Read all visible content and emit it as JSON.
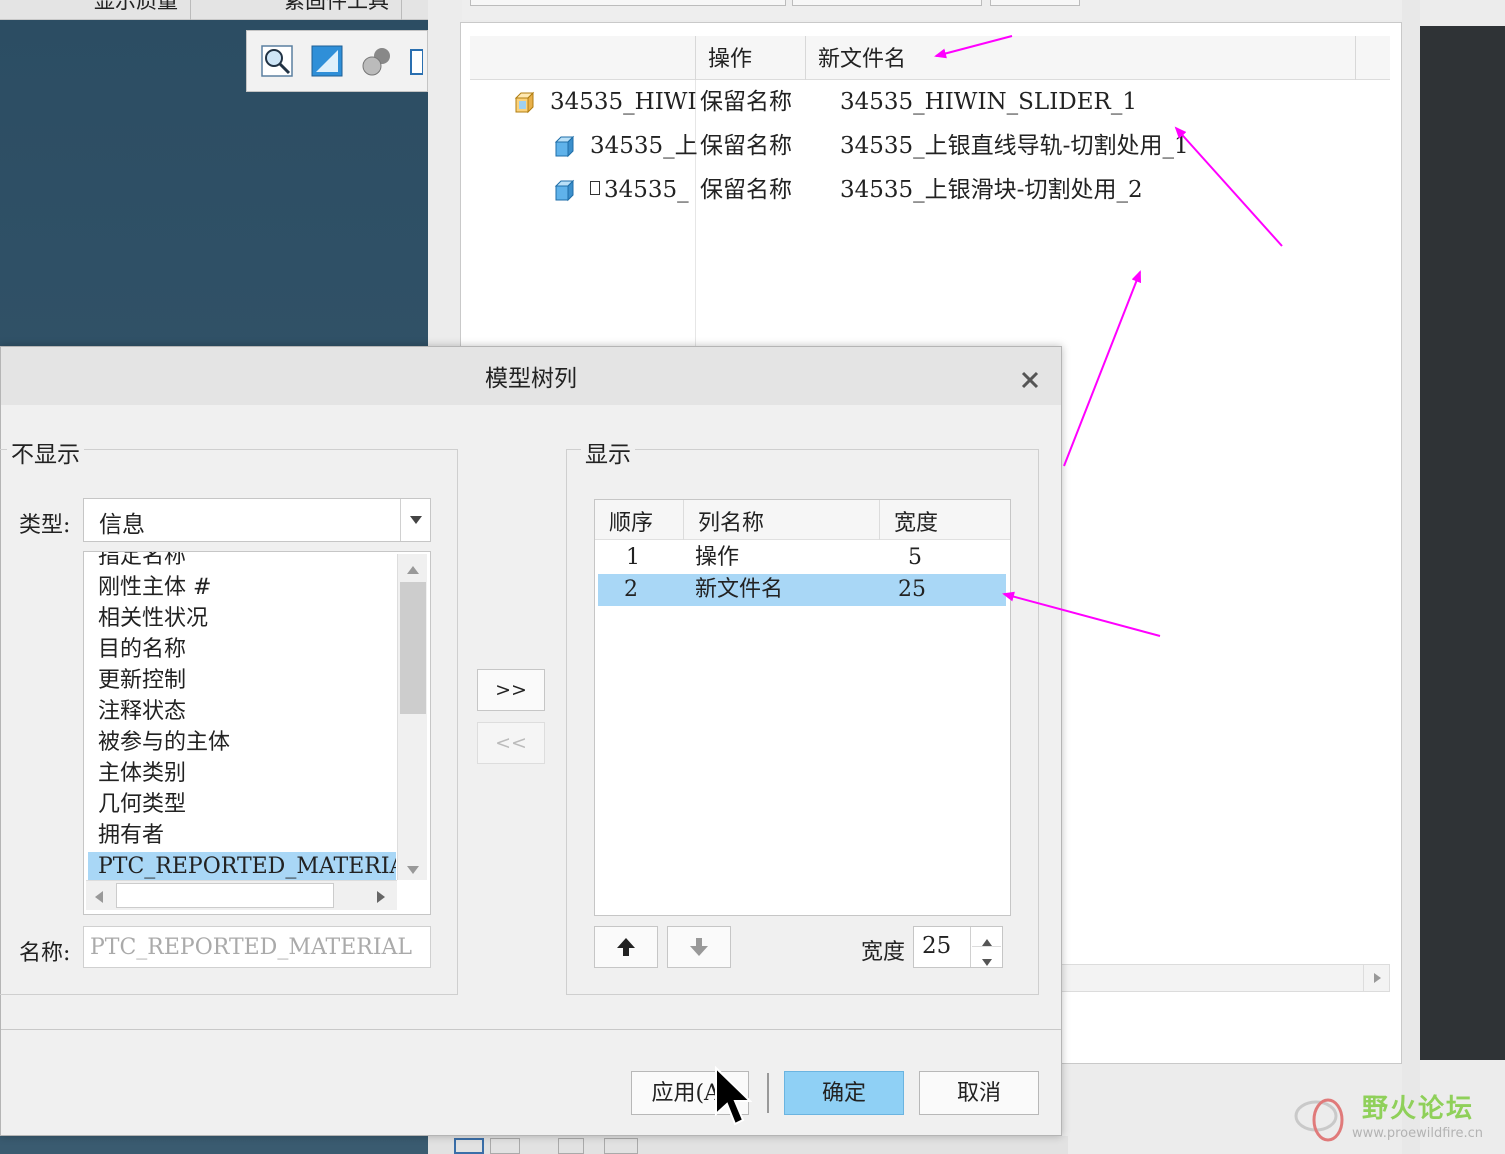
{
  "top_tabs": [
    "显示质量",
    "紧固件工具"
  ],
  "model_tree": {
    "columns": [
      "操作",
      "新文件名"
    ],
    "rows": [
      {
        "name": "34535_HIWI",
        "op": "保留名称",
        "newname": "34535_HIWIN_SLIDER_1"
      },
      {
        "name": "34535_上",
        "op": "保留名称",
        "newname": "34535_上银直线导轨-切割处用_1"
      },
      {
        "name": "34535_",
        "op": "保留名称",
        "newname": "34535_上银滑块-切割处用_2"
      }
    ]
  },
  "dialog": {
    "title": "模型树列",
    "left_group": "不显示",
    "type_label": "类型:",
    "type_value": "信息",
    "available_items": [
      "指定名称",
      "刚性主体 #",
      "相关性状况",
      "目的名称",
      "更新控制",
      "注释状态",
      "被参与的主体",
      "主体类别",
      "几何类型",
      "拥有者",
      "PTC_REPORTED_MATERIAL"
    ],
    "selected_available": "PTC_REPORTED_MATERIAL",
    "name_label": "名称:",
    "name_value": "PTC_REPORTED_MATERIAL",
    "add_button": ">>",
    "remove_button": "<<",
    "right_group": "显示",
    "shown_columns": [
      "顺序",
      "列名称",
      "宽度"
    ],
    "shown_rows": [
      {
        "order": "1",
        "name": "操作",
        "width": "5"
      },
      {
        "order": "2",
        "name": "新文件名",
        "width": "25"
      }
    ],
    "width_label": "宽度",
    "width_value": "25",
    "apply_button": "应用(A)",
    "ok_button": "确定",
    "cancel_button": "取消"
  },
  "watermark": {
    "title": "野火论坛",
    "url": "www.proewildfire.cn"
  },
  "colors": {
    "selection": "#a9d7f6",
    "ok_button": "#8fd0f5",
    "annotation": "#ff00ff",
    "viewport": "#2c4d63"
  }
}
